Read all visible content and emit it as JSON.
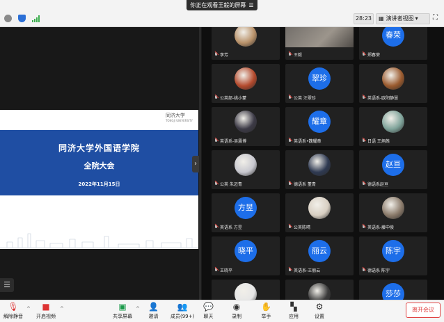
{
  "top": {
    "share_banner": "你正在观看王毅的屏幕",
    "timer": "28:23",
    "view_label": "演讲者视图"
  },
  "slide": {
    "school_logo": "同济大学",
    "school_en": "TONGJI UNIVERSITY",
    "title": "同济大学外国语学院",
    "subtitle": "全院大会",
    "date": "2022年11月15日"
  },
  "participants": [
    {
      "name": "李芳",
      "type": "photo",
      "color": "#b9926a"
    },
    {
      "name": "王毅",
      "type": "photo-wide",
      "color": "#6e6a66"
    },
    {
      "name": "郑春荣",
      "type": "text",
      "avatar": "春荣"
    },
    {
      "name": "公英部-姚小蒙",
      "type": "photo",
      "color": "#b44a2d"
    },
    {
      "name": "公英 汪翠珍",
      "type": "text",
      "avatar": "翠珍"
    },
    {
      "name": "英语系-欧阳静慧",
      "type": "photo",
      "color": "#9a5a2e"
    },
    {
      "name": "英语系-吴震博",
      "type": "photo",
      "color": "#3c3a46"
    },
    {
      "name": "英语系•魏耀章",
      "type": "text",
      "avatar": "耀章"
    },
    {
      "name": "日语 王炳茜",
      "type": "photo",
      "color": "#7fa39a"
    },
    {
      "name": "公英 朱迈青",
      "type": "photo",
      "color": "#c8c8cf"
    },
    {
      "name": "德语系 董青",
      "type": "photo",
      "color": "#2f3a52"
    },
    {
      "name": "德语系赵亘",
      "type": "text",
      "avatar": "赵亘"
    },
    {
      "name": "英语系 方昱",
      "type": "text",
      "avatar": "方昱"
    },
    {
      "name": "公英陈晴",
      "type": "photo",
      "color": "#d8cfc2"
    },
    {
      "name": "英语系-藤中俊",
      "type": "photo",
      "color": "#8a7a6a"
    },
    {
      "name": "王晓平",
      "type": "text",
      "avatar": "晓平"
    },
    {
      "name": "英语系-王丽云",
      "type": "text",
      "avatar": "丽云"
    },
    {
      "name": "德语系 陈宇",
      "type": "text",
      "avatar": "陈宇"
    },
    {
      "name": "",
      "type": "photo",
      "color": "#e6e6e6"
    },
    {
      "name": "",
      "type": "photo",
      "color": "#3a3a3a"
    },
    {
      "name": "",
      "type": "text",
      "avatar": "莎莎"
    }
  ],
  "toolbar": {
    "unmute": "解除静音",
    "start_video": "开启视频",
    "share_screen": "共享屏幕",
    "invite": "邀请",
    "members": "成员(99+)",
    "chat": "聊天",
    "record": "录制",
    "raise_hand": "举手",
    "apps": "应用",
    "settings": "设置",
    "leave": "离开会议"
  },
  "colors": {
    "accent": "#1d6ee9",
    "slide_band": "#1f4ea3",
    "leave": "#e04343"
  }
}
